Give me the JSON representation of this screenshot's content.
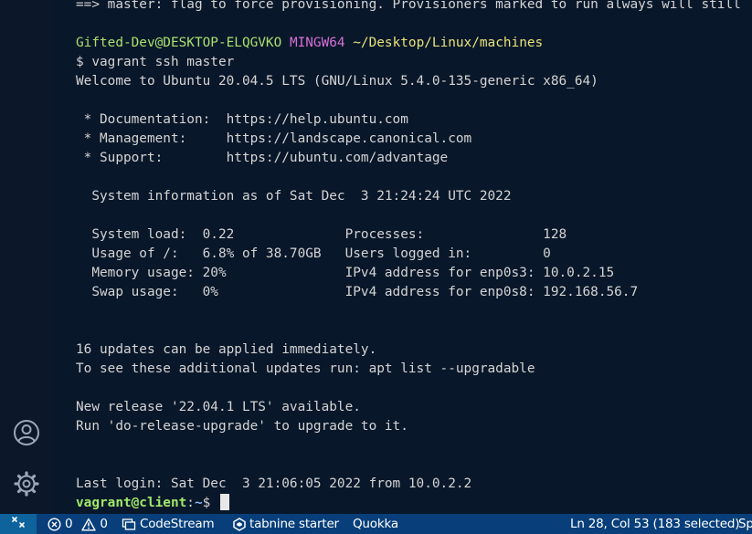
{
  "terminal": {
    "line_flag": "==> master: flag to force provisioning. Provisioners marked to run always will still",
    "prompt": {
      "user_host": "Gifted-Dev@DESKTOP-ELQGVKO",
      "shell": "MINGW64",
      "path": "~/Desktop/Linux/machines"
    },
    "command": "$ vagrant ssh master",
    "welcome": "Welcome to Ubuntu 20.04.5 LTS (GNU/Linux 5.4.0-135-generic x86_64)",
    "doc": " * Documentation:  https://help.ubuntu.com",
    "management": " * Management:     https://landscape.canonical.com",
    "support": " * Support:        https://ubuntu.com/advantage",
    "sysinfo": "  System information as of Sat Dec  3 21:24:24 UTC 2022",
    "sys1": "  System load:  0.22              Processes:               128",
    "sys2": "  Usage of /:   6.8% of 38.70GB   Users logged in:         0",
    "sys3": "  Memory usage: 20%               IPv4 address for enp0s3: 10.0.2.15",
    "sys4": "  Swap usage:   0%                IPv4 address for enp0s8: 192.168.56.7",
    "updates1": "16 updates can be applied immediately.",
    "updates2": "To see these additional updates run: apt list --upgradable",
    "release1": "New release '22.04.1 LTS' available.",
    "release2": "Run 'do-release-upgrade' to upgrade to it.",
    "lastlogin": "Last login: Sat Dec  3 21:06:05 2022 from 10.0.2.2",
    "final_prompt": {
      "user_host": "vagrant@client",
      "sep": ":",
      "path": "~",
      "dollar": "$ "
    }
  },
  "status_bar": {
    "errors": "0",
    "warnings": "0",
    "codestream": "CodeStream",
    "tabnine": "tabnine starter",
    "quokka": "Quokka",
    "position": "Ln 28, Col 53 (183 selected)",
    "spaces": "Sp"
  },
  "colors": {
    "terminal_bg": "#09172a",
    "status_bar_bg": "#083f7a",
    "remote_bg": "#0e639c",
    "prompt_green": "#a8e06d",
    "prompt_magenta": "#d670d6",
    "prompt_yellow": "#e8e37a"
  },
  "icons": {
    "activity_account": "account-icon",
    "activity_settings": "gear-icon",
    "remote": "remote-icon",
    "tabnine": "tabnine-icon"
  }
}
